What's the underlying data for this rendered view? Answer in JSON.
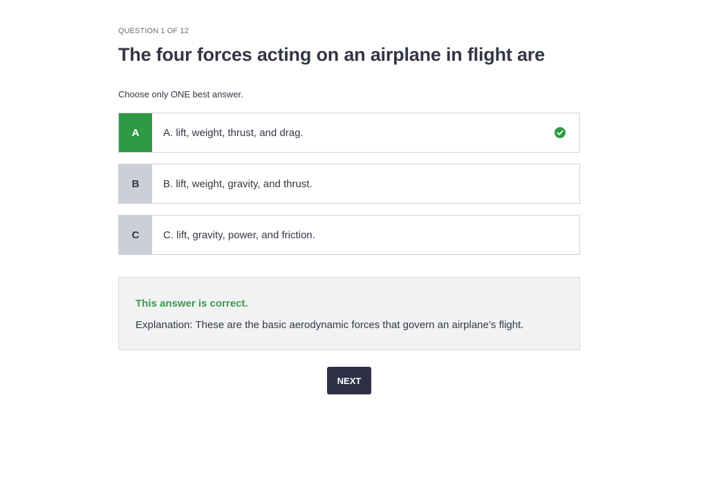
{
  "quiz": {
    "progress": "QUESTION 1 OF 12",
    "question": "The four forces acting on an airplane in flight are",
    "instruction": "Choose only ONE best answer.",
    "options": [
      {
        "letter": "A",
        "text": "A. lift, weight, thrust, and drag.",
        "state": "correct"
      },
      {
        "letter": "B",
        "text": "B. lift, weight, gravity, and thrust.",
        "state": "unselected"
      },
      {
        "letter": "C",
        "text": "C. lift, gravity, power, and friction.",
        "state": "unselected"
      }
    ],
    "feedback": {
      "status": "This answer is correct.",
      "explanation": "Explanation: These are the basic aerodynamic forces that govern an airplane’s flight."
    },
    "next_label": "NEXT"
  },
  "icons": {
    "correct": "check-circle-icon"
  },
  "colors": {
    "correct_green": "#2f9a45",
    "neutral_letter_bg": "#cdcfd8",
    "text_dark": "#333644",
    "button_bg": "#2e3146",
    "feedback_bg": "#f1f2f4"
  }
}
